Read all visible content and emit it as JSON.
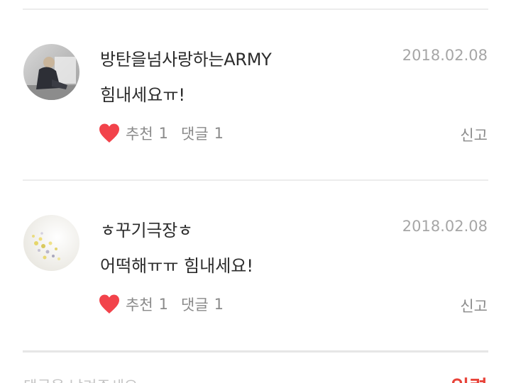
{
  "comments": [
    {
      "username": "방탄을넘사랑하는ARMY",
      "date": "2018.02.08",
      "text": "힘내세요ㅠ!",
      "like_label": "추천",
      "like_count": "1",
      "reply_label": "댓글",
      "reply_count": "1",
      "report_label": "신고"
    },
    {
      "username": "ㅎ꾸기극장ㅎ",
      "date": "2018.02.08",
      "text": "어떡해ㅠㅠ 힘내세요!",
      "like_label": "추천",
      "like_count": "1",
      "reply_label": "댓글",
      "reply_count": "1",
      "report_label": "신고"
    }
  ],
  "footer": {
    "input_placeholder": "댓글을 남겨주세요",
    "submit_label": "입력"
  },
  "colors": {
    "heart": "#f2434b",
    "submit": "#e8443a",
    "date": "#a6a6a6",
    "meta": "#8a8a8a"
  },
  "icons": {
    "like": "heart-icon"
  }
}
